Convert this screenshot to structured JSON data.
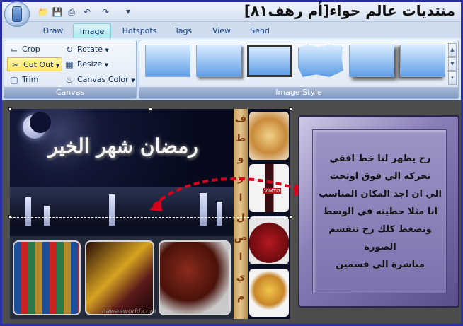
{
  "window": {
    "title": "منتديات عالم حواء[أم رهف٨١]"
  },
  "quick_access": {
    "icons": [
      "folder-icon",
      "save-icon",
      "print-icon",
      "undo-icon",
      "redo-icon",
      "customize-icon"
    ]
  },
  "tabs": [
    {
      "label": "Draw",
      "active": false
    },
    {
      "label": "Image",
      "active": true
    },
    {
      "label": "Hotspots",
      "active": false
    },
    {
      "label": "Tags",
      "active": false
    },
    {
      "label": "View",
      "active": false
    },
    {
      "label": "Send",
      "active": false
    }
  ],
  "ribbon": {
    "canvas_group": {
      "label": "Canvas",
      "crop": "Crop",
      "cut_out": "Cut Out",
      "trim": "Trim",
      "rotate": "Rotate",
      "resize": "Resize",
      "canvas_color": "Canvas Color"
    },
    "image_style_group": {
      "label": "Image Style",
      "thumbnail_count": 6
    }
  },
  "image": {
    "headline": "رمضان شهر الخير",
    "strip_letters": [
      "ف",
      "ط",
      "و",
      "ر",
      "ا",
      "ل",
      "ص",
      "ا",
      "ي",
      "م"
    ],
    "food_labels": {
      "bottle": "VIMTO"
    },
    "watermark": "hawaaworld.com"
  },
  "note": {
    "lines": [
      "رح يظهر لنا خط افقي",
      "نحركه الي فوق اوتحت",
      "الي ان اجد المكان المناسب",
      "انا مثلا حطيته في الوسط",
      "ونضغط كلك رح تنقسم الصورة",
      "مباشرة الي قسمين"
    ]
  },
  "colors": {
    "frame": "#2a2fa8",
    "ribbon": "#c9d9ef",
    "active_tab": "#a9e6ee",
    "highlight": "#ffe566",
    "arrow": "#d6001c",
    "note_box": "#8b7fb8"
  }
}
